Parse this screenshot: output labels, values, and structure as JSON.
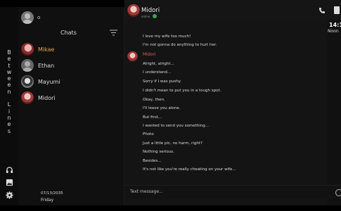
{
  "user": {
    "name": "o"
  },
  "rail": {
    "title_letters": [
      "B",
      "e",
      "t",
      "w",
      "e",
      "e",
      "n",
      "",
      "L",
      "i",
      "n",
      "e",
      "s"
    ]
  },
  "chats": {
    "header": "Chats",
    "contacts": [
      {
        "name": "Mikae",
        "active": true
      },
      {
        "name": "Ethan",
        "active": false
      },
      {
        "name": "Mayumi",
        "active": false
      },
      {
        "name": "Midori",
        "active": false
      }
    ]
  },
  "footer": {
    "date": "07/13/2035",
    "day": "Friday"
  },
  "conversation": {
    "contact_name": "Midori",
    "status": "online",
    "sender_label": "Midori",
    "messages": [
      "I love my wife too much!",
      "I'm not gonna do anything to hurt her.",
      "Alright, alright...",
      "I understand...",
      "Sorry if I was pushy.",
      "I didn't mean to put you in a tough spot.",
      "Okay, then.",
      "I'll leave you alone.",
      "But first...",
      "I wanted to send you something...",
      "Photo",
      "Just a little pic, no harm, right?",
      "Nothing serious.",
      "Besides...",
      "It's not like you're really cheating on your wife..."
    ]
  },
  "clock": {
    "time": "14:1",
    "label": "Noon"
  },
  "composer": {
    "placeholder": "Text message..."
  },
  "colors": {
    "active_contact": "#e0a74d",
    "sender_name": "#e06050",
    "online": "#3aa64a"
  }
}
